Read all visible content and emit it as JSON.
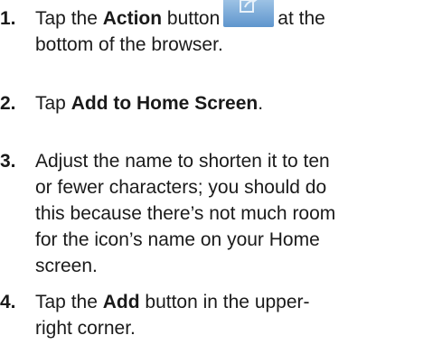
{
  "steps": [
    {
      "number": "1.",
      "lines": [
        [
          "Tap the ",
          "Action",
          " button",
          "at the"
        ],
        [
          "bottom of the browser."
        ]
      ],
      "icon": "action-share-icon"
    },
    {
      "number": "2.",
      "lines": [
        [
          "Tap ",
          "Add to Home Screen",
          "."
        ]
      ]
    },
    {
      "number": "3.",
      "lines": [
        [
          "Adjust the name to shorten it to ten"
        ],
        [
          "or fewer characters; you should do"
        ],
        [
          "this because there’s not much room"
        ],
        [
          "for the icon’s name on your Home"
        ],
        [
          "screen."
        ]
      ]
    },
    {
      "number": "4.",
      "lines": [
        [
          "Tap the ",
          "Add",
          " button in the upper-"
        ],
        [
          "right corner."
        ]
      ]
    }
  ],
  "colors": {
    "text": "#1a1a1a",
    "icon_top": "#a9cbe9",
    "icon_bottom": "#5e95cd"
  }
}
